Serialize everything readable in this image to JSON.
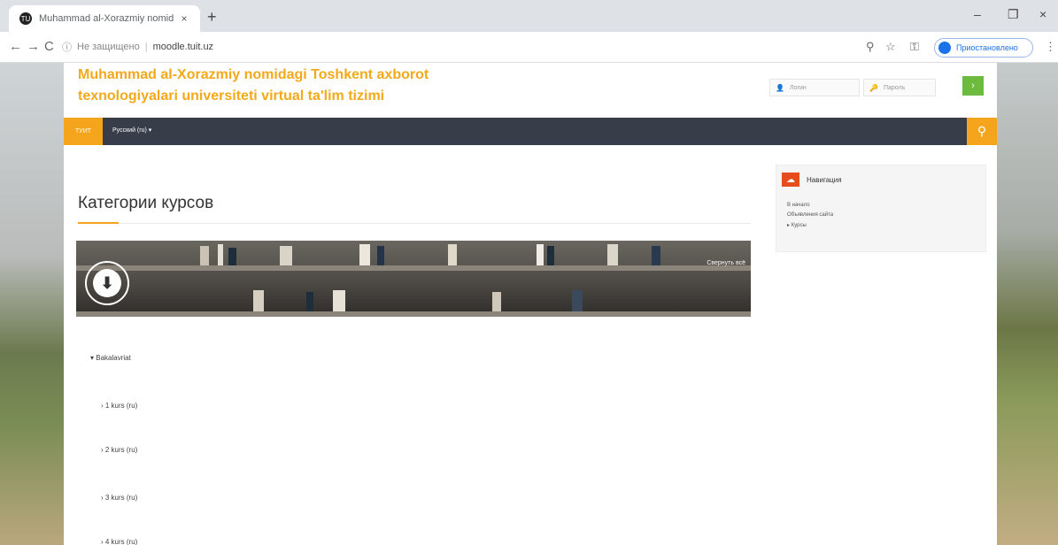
{
  "browser": {
    "tab_title": "Muhammad al-Xorazmiy nomid",
    "tab_close": "×",
    "new_tab": "+",
    "back": "←",
    "forward": "→",
    "reload": "C",
    "not_secure": "Не защищено",
    "url": "moodle.tuit.uz",
    "profile_label": "Приостановлено",
    "win_min": "–",
    "win_max": "❐",
    "win_close": "×"
  },
  "site": {
    "title_line1": "Muhammad al-Xorazmiy nomidagi Toshkent axborot",
    "title_line2": "texnologiyalari universiteti virtual ta'lim tizimi",
    "login_user_placeholder": "Логин",
    "login_pass_placeholder": "Пароль",
    "login_button": "›"
  },
  "navbar": {
    "home": "ТУИТ",
    "language": "Русский (ru) ▾",
    "search_icon": "search-icon"
  },
  "main": {
    "heading": "Категории курсов",
    "collapse_all": "Свернуть всё",
    "categories": [
      {
        "label": "▾ Bakalavriat"
      },
      {
        "label": "› 1 kurs (ru)"
      },
      {
        "label": "› 2 kurs (ru)"
      },
      {
        "label": "› 3 kurs (ru)"
      },
      {
        "label": "› 4 kurs (ru)"
      }
    ]
  },
  "navigation_block": {
    "title": "Навигация",
    "items": [
      {
        "label": "В начало"
      },
      {
        "label": "Объявления сайта"
      },
      {
        "label": "▸ Курсы"
      }
    ]
  },
  "colors": {
    "accent": "#f4a51c",
    "navbar": "#373e4a",
    "login_button": "#6dbb3e"
  }
}
